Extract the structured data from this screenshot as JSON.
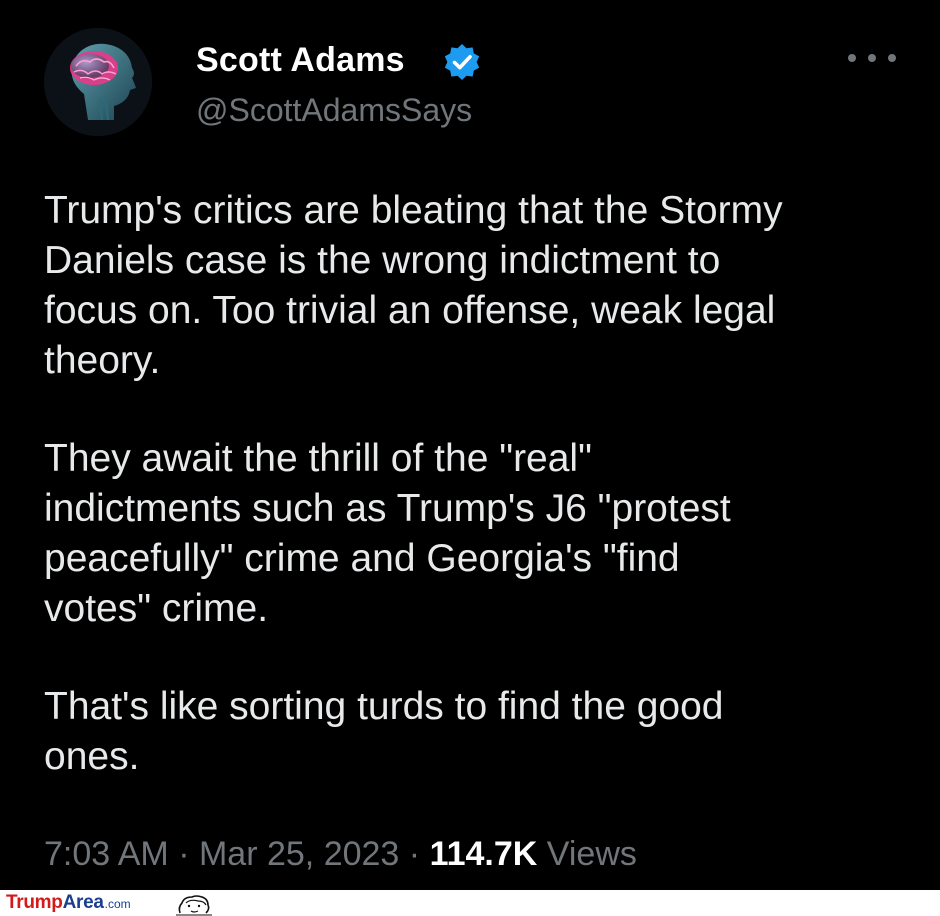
{
  "author": {
    "display_name": "Scott Adams",
    "handle": "@ScottAdamsSays",
    "verified": true,
    "avatar_icon": "brain-profile-avatar",
    "verified_icon": "verified-badge-icon",
    "verified_color": "#1d9bf0"
  },
  "tweet": {
    "paragraphs": [
      "Trump's critics are bleating that the Stormy\nDaniels case is the wrong indictment to\nfocus on. Too trivial an offense, weak legal\ntheory.",
      "They await the thrill of the \"real\"\nindictments such as Trump's J6 \"protest\npeacefully\" crime and Georgia's \"find\nvotes\" crime.",
      "That's like sorting turds to find the good\nones."
    ]
  },
  "meta": {
    "time": "7:03 AM",
    "separator": "·",
    "date": "Mar 25, 2023",
    "views_count": "114.7K",
    "views_label": "Views"
  },
  "more_menu": {
    "icon": "more-horizontal-icon"
  },
  "watermark": {
    "part1": "Trump",
    "part2": "Area",
    "suffix": ".com",
    "colors": {
      "part1": "#d11a1a",
      "part2": "#1b3f8f"
    },
    "mascot_icon": "caricature-face-icon"
  },
  "colors": {
    "background": "#000000",
    "text": "#e7e9ea",
    "secondary_text": "#71767b"
  }
}
